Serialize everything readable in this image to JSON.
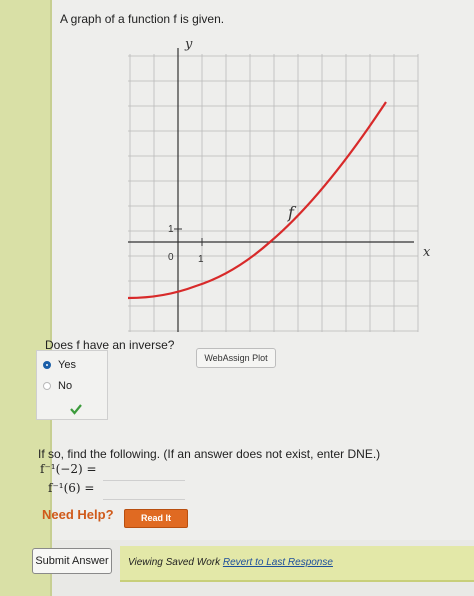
{
  "question": {
    "prompt": "A graph of a function f is given."
  },
  "graph": {
    "x_label": "x",
    "y_label": "y",
    "curve_label": "f",
    "tick_x": "1",
    "tick_y": "1",
    "origin_label": "0",
    "curve_color": "#d82a2a",
    "plot_button": "WebAssign Plot"
  },
  "inverse": {
    "question": "Does f have an inverse?",
    "options": [
      "Yes",
      "No"
    ],
    "selected": "Yes",
    "correct_mark": "check-icon"
  },
  "find": {
    "instruction": "If so, find the following. (If an answer does not exist, enter DNE.)",
    "item1_label": "f⁻¹(−2) =",
    "item2_label": "f⁻¹(6) =",
    "item1_value": "",
    "item2_value": ""
  },
  "help": {
    "label": "Need Help?",
    "read_it": "Read It"
  },
  "footer": {
    "submit": "Submit Answer",
    "saved_text": "Viewing Saved Work",
    "revert_link": "Revert to Last Response"
  }
}
